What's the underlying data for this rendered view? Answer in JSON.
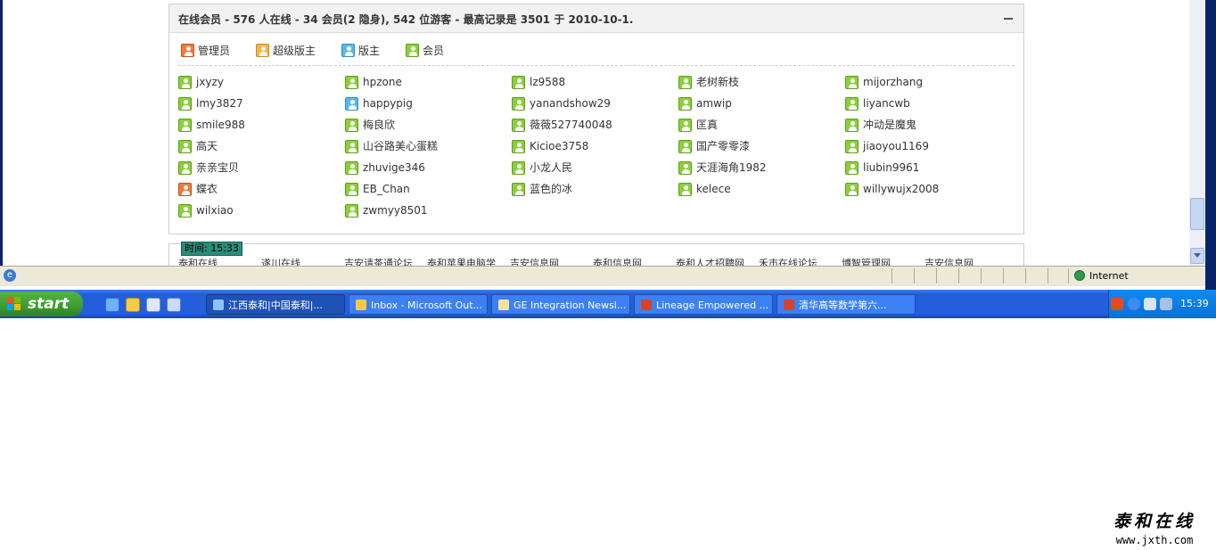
{
  "online": {
    "title": "在线会员 - 576 人在线 - 34 会员(2 隐身), 542 位游客 - 最高记录是 3501 于 2010-10-1.",
    "legend": [
      {
        "label": "管理员",
        "role": "admin"
      },
      {
        "label": "超级版主",
        "role": "super"
      },
      {
        "label": "版主",
        "role": "mod"
      },
      {
        "label": "会员",
        "role": "member"
      }
    ],
    "members": [
      {
        "name": "jxyzy",
        "role": "member"
      },
      {
        "name": "hpzone",
        "role": "member"
      },
      {
        "name": "lz9588",
        "role": "member"
      },
      {
        "name": "老树新枝",
        "role": "member"
      },
      {
        "name": "mijorzhang",
        "role": "member"
      },
      {
        "name": "lmy3827",
        "role": "member"
      },
      {
        "name": "happypig",
        "role": "mod"
      },
      {
        "name": "yanandshow29",
        "role": "member"
      },
      {
        "name": "amwip",
        "role": "member"
      },
      {
        "name": "liyancwb",
        "role": "member"
      },
      {
        "name": "smile988",
        "role": "member"
      },
      {
        "name": "梅良欣",
        "role": "member"
      },
      {
        "name": "薇薇527740048",
        "role": "member"
      },
      {
        "name": "匡真",
        "role": "member"
      },
      {
        "name": "冲动是魔鬼",
        "role": "member"
      },
      {
        "name": "高天",
        "role": "member"
      },
      {
        "name": "山谷路美心蛋糕",
        "role": "member"
      },
      {
        "name": "Kicioe3758",
        "role": "member"
      },
      {
        "name": "国产零零漆",
        "role": "member"
      },
      {
        "name": "jiaoyou1169",
        "role": "member"
      },
      {
        "name": "亲亲宝贝",
        "role": "member"
      },
      {
        "name": "zhuvige346",
        "role": "member"
      },
      {
        "name": "小龙人民",
        "role": "member"
      },
      {
        "name": "天涯海角1982",
        "role": "member"
      },
      {
        "name": "liubin9961",
        "role": "member"
      },
      {
        "name": "蝶衣",
        "role": "admin"
      },
      {
        "name": "EB_Chan",
        "role": "member"
      },
      {
        "name": "蓝色的冰",
        "role": "member"
      },
      {
        "name": "kelece",
        "role": "member"
      },
      {
        "name": "willywujx2008",
        "role": "member"
      },
      {
        "name": "wilxiao",
        "role": "member"
      },
      {
        "name": "zwmyy8501",
        "role": "member"
      }
    ]
  },
  "links": {
    "time_badge": "时间: 15:33",
    "sites": [
      "泰和在线",
      "遂川在线",
      "吉安请茶通论坛",
      "泰和苹果电脑学",
      "吉安信息网",
      "泰和信息网",
      "泰和人才招聘网",
      "禾市在线论坛",
      "博智管理网",
      "吉安信息网"
    ]
  },
  "status_bar": {
    "zone": "Internet"
  },
  "taskbar": {
    "start_label": "start",
    "windows": [
      {
        "label": "江西泰和|中国泰和|...",
        "active": true,
        "icon": "ie-icon"
      },
      {
        "label": "Inbox - Microsoft Out...",
        "active": false,
        "icon": "outlook-icon"
      },
      {
        "label": "GE Integration Newsl...",
        "active": false,
        "icon": "mail-icon"
      },
      {
        "label": "Lineage Empowered ...",
        "active": false,
        "icon": "pdf-icon"
      },
      {
        "label": "清华高等数学第六...",
        "active": false,
        "icon": "pdf-icon"
      }
    ],
    "clock": "15:39"
  },
  "watermark": {
    "title": "泰和在线",
    "url": "www.jxth.com"
  },
  "colors": {
    "member": "#8ccf3c",
    "admin": "#f07c3c",
    "super": "#f5b34a",
    "mod": "#5cb8e8",
    "taskbar": "#245edb",
    "start": "#3c9b2f"
  }
}
